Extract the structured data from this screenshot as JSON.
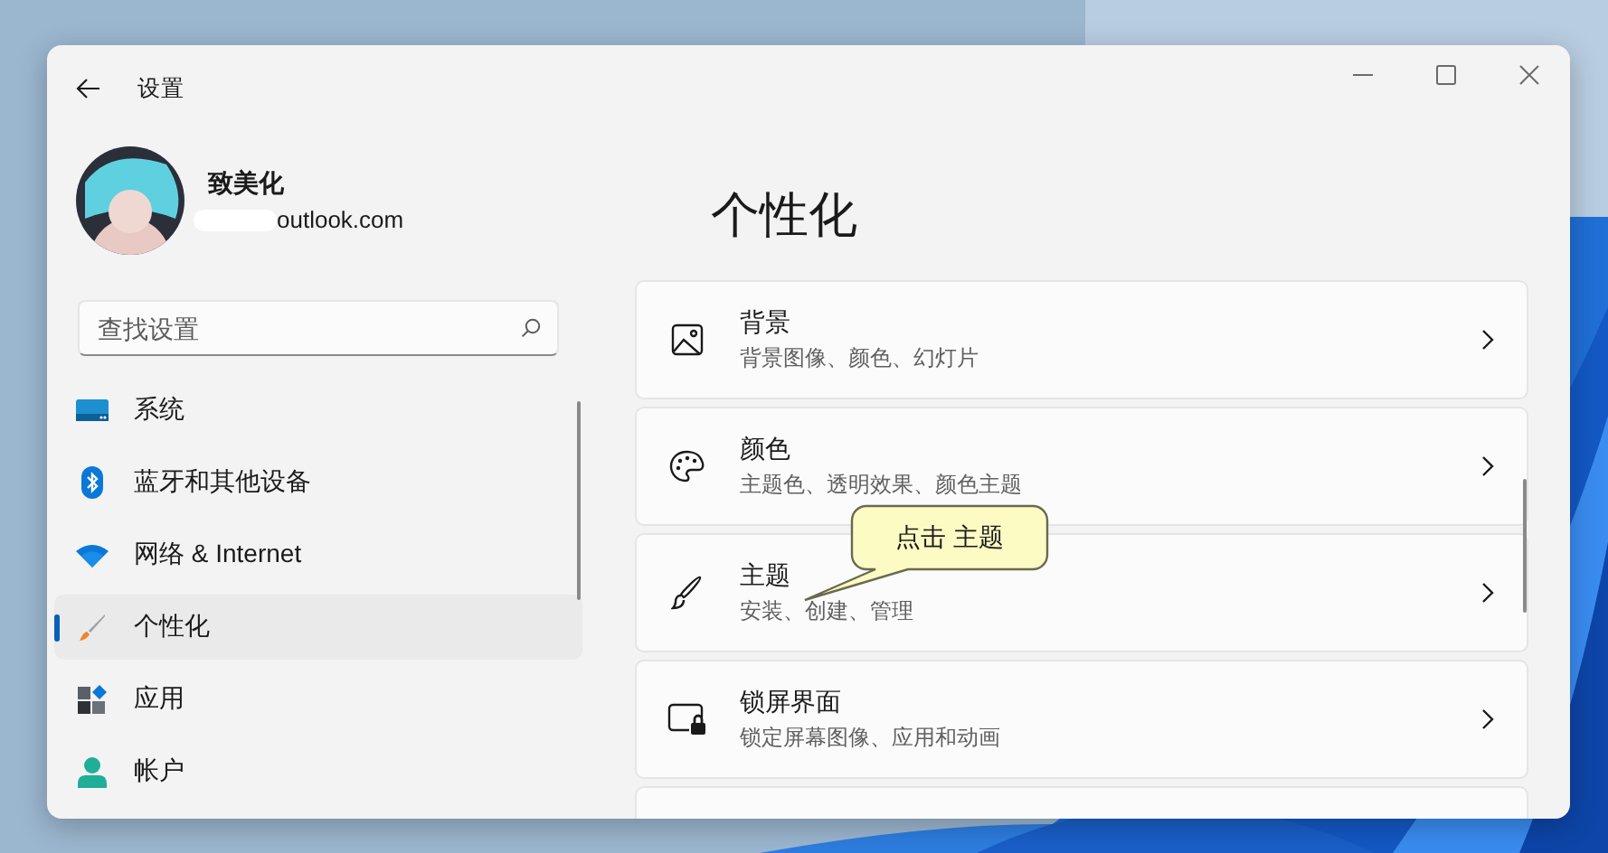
{
  "window": {
    "title": "设置"
  },
  "profile": {
    "name": "致美化",
    "email": "outlook.com"
  },
  "search": {
    "placeholder": "查找设置"
  },
  "sidebar": {
    "items": [
      {
        "label": "系统",
        "selected": false
      },
      {
        "label": "蓝牙和其他设备",
        "selected": false
      },
      {
        "label": "网络 & Internet",
        "selected": false
      },
      {
        "label": "个性化",
        "selected": true
      },
      {
        "label": "应用",
        "selected": false
      },
      {
        "label": "帐户",
        "selected": false
      }
    ]
  },
  "page": {
    "title": "个性化"
  },
  "cards": [
    {
      "title": "背景",
      "subtitle": "背景图像、颜色、幻灯片"
    },
    {
      "title": "颜色",
      "subtitle": "主题色、透明效果、颜色主题"
    },
    {
      "title": "主题",
      "subtitle": "安装、创建、管理"
    },
    {
      "title": "锁屏界面",
      "subtitle": "锁定屏幕图像、应用和动画"
    }
  ],
  "callout": {
    "text": "点击 主题"
  }
}
